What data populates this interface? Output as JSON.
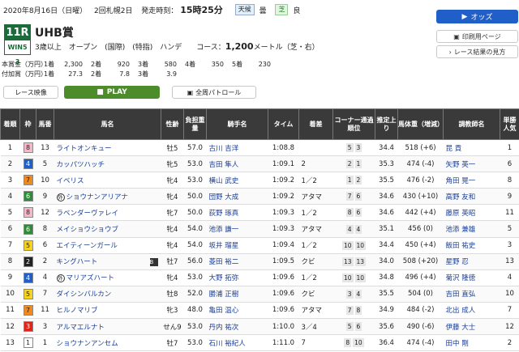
{
  "header": {
    "date": "2020年8月16日（日曜）",
    "meeting": "2回札幌2日",
    "post_time_label": "発走時刻：",
    "post_time": "15時25分",
    "weather_label": "天候",
    "weather": "曇",
    "track_label": "芝",
    "track_condition": "良"
  },
  "race": {
    "number": "11R",
    "win5": "WIN5 3",
    "name": "UHB賞",
    "conditions": "3歳以上　オープン　(国際)　(特指)　ハンデ　　コース：",
    "distance": "1,200",
    "distance_unit": "メートル（芝・右）"
  },
  "prizes": {
    "rows": [
      {
        "label": "本賞金（万円）",
        "values": [
          "1着",
          "2,300",
          "2着",
          "920",
          "3着",
          "580",
          "4着",
          "350",
          "5着",
          "230"
        ]
      },
      {
        "label": "付加賞（万円）",
        "values": [
          "1着",
          "27.3",
          "2着",
          "7.8",
          "3着",
          "3.9"
        ]
      }
    ]
  },
  "buttons": {
    "odds": "オッズ",
    "print": "印刷用ページ",
    "results": "レース結果の見方",
    "video": "レース映像",
    "play": "PLAY",
    "patrol": "全周パトロール"
  },
  "table": {
    "headers": [
      "着順",
      "枠",
      "馬番",
      "馬名",
      "性齢",
      "負担重量",
      "騎手名",
      "タイム",
      "着差",
      "コーナー通過順位",
      "推定上り",
      "馬体重（増減）",
      "調教師名",
      "単勝人気"
    ],
    "rows": [
      {
        "rank": "1",
        "waku": "8",
        "num": "13",
        "horse": "ライトオンキュー",
        "sexage": "牡5",
        "weight": "57.0",
        "jockey": "古川 吉洋",
        "time": "1:08.8",
        "margin": "",
        "corner": [
          "5",
          "3"
        ],
        "agari": "34.4",
        "body": "518 (+6)",
        "trainer": "昆 貢",
        "pop": "1"
      },
      {
        "rank": "2",
        "waku": "4",
        "num": "5",
        "horse": "カッパツハッチ",
        "sexage": "牝5",
        "weight": "53.0",
        "jockey": "吉田 隼人",
        "time": "1:09.1",
        "margin": "2",
        "corner": [
          "2",
          "1"
        ],
        "agari": "35.3",
        "body": "474 (-4)",
        "trainer": "矢野 英一",
        "pop": "6"
      },
      {
        "rank": "3",
        "waku": "7",
        "num": "10",
        "horse": "イベリス",
        "sexage": "牝4",
        "weight": "53.0",
        "jockey": "横山 武史",
        "time": "1:09.2",
        "margin": "1／2",
        "corner": [
          "1",
          "2"
        ],
        "agari": "35.5",
        "body": "476 (-2)",
        "trainer": "角田 晃一",
        "pop": "8"
      },
      {
        "rank": "4",
        "waku": "6",
        "num": "9",
        "horse": "ショウナンアリアナ",
        "sexage": "牝4",
        "weight": "50.0",
        "jockey": "団野 大成",
        "time": "1:09.2",
        "margin": "アタマ",
        "corner": [
          "7",
          "6"
        ],
        "agari": "34.6",
        "body": "430 (+10)",
        "trainer": "高野 友和",
        "pop": "9",
        "mark": "外"
      },
      {
        "rank": "5",
        "waku": "8",
        "num": "12",
        "horse": "ラベンダーヴァレイ",
        "sexage": "牝7",
        "weight": "50.0",
        "jockey": "荻野 琢真",
        "time": "1:09.3",
        "margin": "1／2",
        "corner": [
          "8",
          "6"
        ],
        "agari": "34.6",
        "body": "442 (+4)",
        "trainer": "藤原 英昭",
        "pop": "11"
      },
      {
        "rank": "6",
        "waku": "6",
        "num": "8",
        "horse": "メイショウショウブ",
        "sexage": "牝4",
        "weight": "54.0",
        "jockey": "池添 謙一",
        "time": "1:09.3",
        "margin": "アタマ",
        "corner": [
          "4",
          "4"
        ],
        "agari": "35.1",
        "body": "456 (0)",
        "trainer": "池添 兼雄",
        "pop": "5"
      },
      {
        "rank": "7",
        "waku": "5",
        "num": "6",
        "horse": "エイティーンガール",
        "sexage": "牝4",
        "weight": "54.0",
        "jockey": "坂井 瑠星",
        "time": "1:09.4",
        "margin": "1／2",
        "corner": [
          "10",
          "10"
        ],
        "agari": "34.4",
        "body": "450 (+4)",
        "trainer": "飯田 祐史",
        "pop": "3"
      },
      {
        "rank": "8",
        "waku": "2",
        "num": "2",
        "horse": "キングハート",
        "sexage": "牡7",
        "weight": "56.0",
        "jockey": "菱田 裕二",
        "time": "1:09.5",
        "margin": "クビ",
        "corner": [
          "13",
          "13"
        ],
        "agari": "34.0",
        "body": "508 (+20)",
        "trainer": "星野 忍",
        "pop": "13",
        "blinker": "B"
      },
      {
        "rank": "9",
        "waku": "4",
        "num": "4",
        "horse": "マリアズハート",
        "sexage": "牝4",
        "weight": "53.0",
        "jockey": "大野 拓弥",
        "time": "1:09.6",
        "margin": "1／2",
        "corner": [
          "10",
          "10"
        ],
        "agari": "34.8",
        "body": "496 (+4)",
        "trainer": "菊沢 隆徳",
        "pop": "4",
        "mark": "外"
      },
      {
        "rank": "10",
        "waku": "5",
        "num": "7",
        "horse": "ダイシンバルカン",
        "sexage": "牡8",
        "weight": "52.0",
        "jockey": "勝浦 正樹",
        "time": "1:09.6",
        "margin": "クビ",
        "corner": [
          "3",
          "4"
        ],
        "agari": "35.5",
        "body": "504 (0)",
        "trainer": "吉田 直弘",
        "pop": "10"
      },
      {
        "rank": "11",
        "waku": "7",
        "num": "11",
        "horse": "ヒルノマリブ",
        "sexage": "牝3",
        "weight": "48.0",
        "jockey": "亀田 温心",
        "time": "1:09.6",
        "margin": "アタマ",
        "corner": [
          "7",
          "8"
        ],
        "agari": "34.9",
        "body": "484 (-2)",
        "trainer": "北出 成人",
        "pop": "7"
      },
      {
        "rank": "12",
        "waku": "3",
        "num": "3",
        "horse": "アルマエルナト",
        "sexage": "せん9",
        "weight": "53.0",
        "jockey": "丹内 祐次",
        "time": "1:10.0",
        "margin": "3／4",
        "corner": [
          "5",
          "6"
        ],
        "agari": "35.6",
        "body": "490 (-6)",
        "trainer": "伊藤 大士",
        "pop": "12"
      },
      {
        "rank": "13",
        "waku": "1",
        "num": "1",
        "horse": "ショウナンアンセム",
        "sexage": "牡7",
        "weight": "53.0",
        "jockey": "石川 裕紀人",
        "time": "1:11.0",
        "margin": "7",
        "corner": [
          "8",
          "10"
        ],
        "agari": "36.4",
        "body": "474 (-4)",
        "trainer": "田中 剛",
        "pop": "2"
      }
    ]
  },
  "colors": {
    "waku": {
      "1": "#ffffff",
      "2": "#222222",
      "3": "#e2231a",
      "4": "#1f5fc7",
      "5": "#f7d31f",
      "6": "#2e8b3a",
      "7": "#f08a1e",
      "8": "#f7b8c8"
    },
    "waku_text": {
      "1": "#222",
      "2": "#fff",
      "3": "#fff",
      "4": "#fff",
      "5": "#222",
      "6": "#fff",
      "7": "#222",
      "8": "#222"
    }
  }
}
